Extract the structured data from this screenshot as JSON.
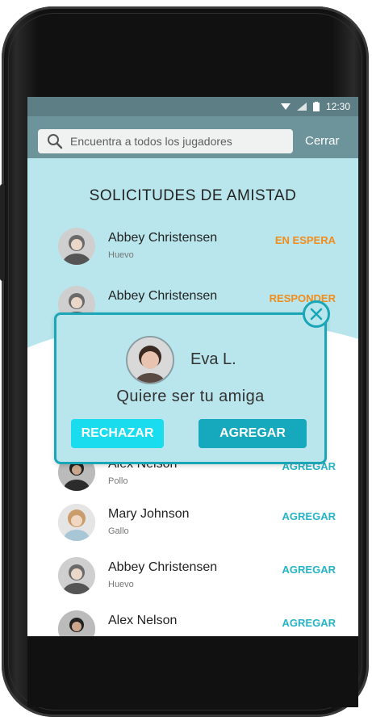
{
  "status_bar": {
    "time": "12:30"
  },
  "search": {
    "placeholder": "Encuentra a todos los jugadores",
    "close_label": "Cerrar"
  },
  "section_title": "SOLICITUDES DE AMISTAD",
  "list": [
    {
      "name": "Abbey Christensen",
      "sub": "Huevo",
      "action": "EN ESPERA",
      "action_color": "#f28c1a"
    },
    {
      "name": "Abbey Christensen",
      "sub": "",
      "action": "RESPONDER",
      "action_color": "#f28c1a"
    },
    {
      "name": "Alex Nelson",
      "sub": "Pollo",
      "action": "AGREGAR",
      "action_color": "#25b4c6"
    },
    {
      "name": "Mary Johnson",
      "sub": "Gallo",
      "action": "AGREGAR",
      "action_color": "#25b4c6"
    },
    {
      "name": "Abbey Christensen",
      "sub": "Huevo",
      "action": "AGREGAR",
      "action_color": "#25b4c6"
    },
    {
      "name": "Alex Nelson",
      "sub": "",
      "action": "AGREGAR",
      "action_color": "#25b4c6"
    }
  ],
  "dialog": {
    "name": "Eva L.",
    "message": "Quiere ser tu amiga",
    "reject_label": "RECHAZAR",
    "accept_label": "AGREGAR"
  },
  "colors": {
    "accent": "#1aa6b7",
    "orange": "#f28c1a",
    "light_bg": "#b8e6ec"
  }
}
